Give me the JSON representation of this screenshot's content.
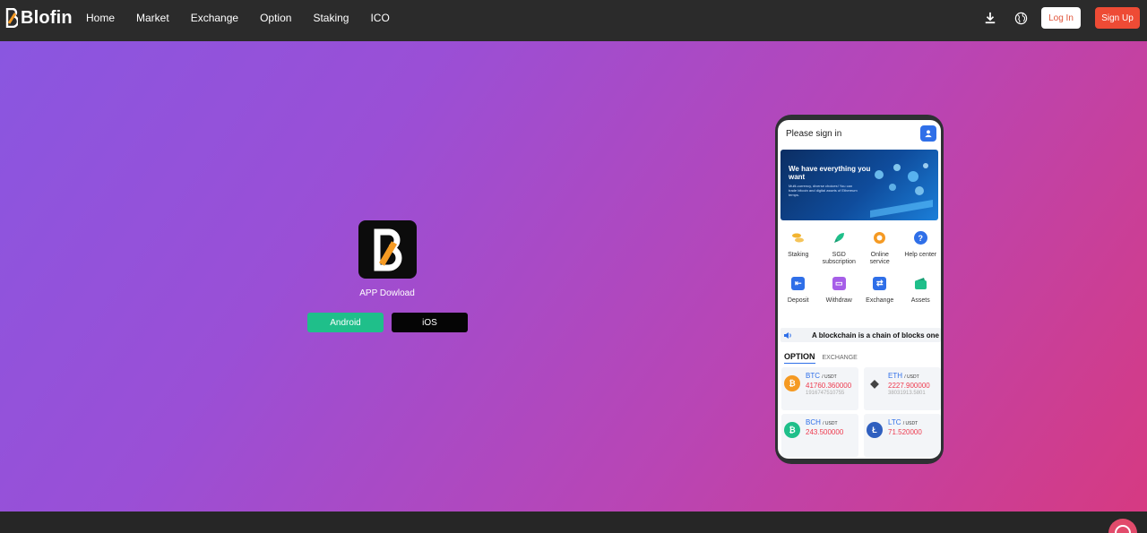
{
  "brand": {
    "name": "Blofin",
    "accent": "#ee4b35"
  },
  "nav": {
    "items": [
      "Home",
      "Market",
      "Exchange",
      "Option",
      "Staking",
      "ICO"
    ],
    "login_label": "Log In",
    "signup_label": "Sign Up",
    "icons": [
      "download-icon",
      "globe-icon"
    ]
  },
  "hero": {
    "app_title": "APP Dowload",
    "android_label": "Android",
    "ios_label": "iOS",
    "gradient": [
      "#8a56e0",
      "#d63a82"
    ]
  },
  "phone": {
    "header_text": "Please sign in",
    "banner_title": "We have everything you want",
    "banner_sub": "Multi-currency, diverse choices! You can trade bitcoin and digital assets of Ethereum temps.",
    "menu": [
      {
        "label": "Staking",
        "icon": "coins-icon",
        "color": "#f2b431"
      },
      {
        "label": "SGD subscription",
        "icon": "rocket-icon",
        "color": "#1fbf8a"
      },
      {
        "label": "Online service",
        "icon": "headset-icon",
        "color": "#f59a23"
      },
      {
        "label": "Help center",
        "icon": "question-icon",
        "color": "#2f6fe8"
      },
      {
        "label": "Deposit",
        "icon": "deposit-icon",
        "color": "#2f6fe8"
      },
      {
        "label": "Withdraw",
        "icon": "wallet-icon",
        "color": "#a65ee8"
      },
      {
        "label": "Exchange",
        "icon": "swap-icon",
        "color": "#2f6fe8"
      },
      {
        "label": "Assets",
        "icon": "assets-icon",
        "color": "#1fbf8a"
      }
    ],
    "ticker_text": "A blockchain is a chain of blocks one",
    "tab_active": "OPTION",
    "tab_other": "EXCHANGE",
    "markets": [
      {
        "symbol": "BTC",
        "quote": "/ USDT",
        "price": "41760.360000",
        "volume": "1916747510755",
        "color": "#f59a23",
        "glyph": "₿"
      },
      {
        "symbol": "ETH",
        "quote": "/ USDT",
        "price": "2227.900000",
        "volume": "38031913.5801",
        "color": "#555555",
        "glyph": "◆"
      },
      {
        "symbol": "BCH",
        "quote": "/ USDT",
        "price": "243.500000",
        "volume": "",
        "color": "#1fbf8a",
        "glyph": "₿"
      },
      {
        "symbol": "LTC",
        "quote": "/ USDT",
        "price": "71.520000",
        "volume": "",
        "color": "#2f5fbf",
        "glyph": "Ł"
      }
    ]
  }
}
